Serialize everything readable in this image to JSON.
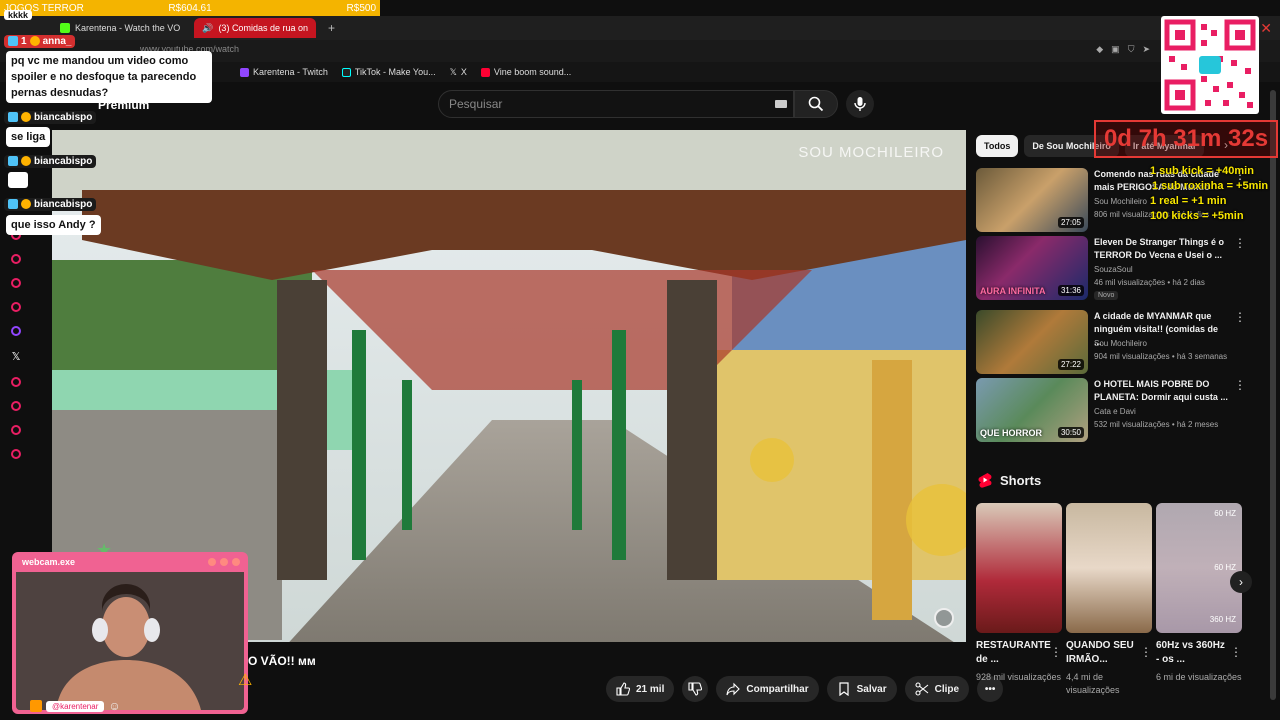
{
  "overlay": {
    "goal_bar": [
      "JOGOS TERROR",
      "R$604.61",
      "R$500"
    ],
    "chat": [
      {
        "kind": "text-only",
        "text": "kkkk"
      },
      {
        "kind": "message",
        "user": "anna_",
        "badge": "1",
        "text": "pq vc me mandou um video como spoiler e no desfoque ta parecendo pernas desnudas?"
      },
      {
        "kind": "message",
        "user": "biancabispo",
        "text": "se liga"
      },
      {
        "kind": "message",
        "user": "biancabispo",
        "text": ""
      },
      {
        "kind": "message",
        "user": "biancabispo",
        "text": "que isso Andy ?"
      }
    ],
    "timer": "0d 7h 31m 32s",
    "rules": [
      "1 sub kick = +40min",
      "1 sub roxinha = +5min",
      "1 real = +1 min",
      "100 kicks = +5min"
    ],
    "webcam_title": "webcam.exe",
    "handle": "@karentenar"
  },
  "browser": {
    "tabs": [
      {
        "label": "Karentena - Watch the VO",
        "active": false
      },
      {
        "label": "(3) Comidas de rua on",
        "active": true
      }
    ],
    "url": "www.youtube.com/watch",
    "bookmarks": [
      "Karentena - Twitch",
      "TikTok - Make You...",
      "X",
      "Vine boom sound..."
    ]
  },
  "youtube": {
    "premium_label": "Premium",
    "search_placeholder": "Pesquisar",
    "video": {
      "watermark": "SOU MOCHILEIRO",
      "title_fragment": "O VÃO!! мм",
      "likes": "21 mil",
      "share": "Compartilhar",
      "save": "Salvar",
      "clip": "Clipe"
    },
    "chips": [
      "Todos",
      "De Sou Mochileiro",
      "Ir até Myanmar"
    ],
    "recommendations": [
      {
        "title": "Comendo nas ruas da cidade mais PERIGOSA do Mundo",
        "channel": "Sou Mochileiro",
        "meta": "806 mil visualizações • há 4 dias",
        "duration": "27:05",
        "badge": "",
        "thumb_text": ""
      },
      {
        "title": "Eleven De Stranger Things é o TERROR Do Vecna e Usei o ...",
        "channel": "SouzaSoul",
        "meta": "46 mil visualizações • há 2 dias",
        "duration": "31:36",
        "badge": "Novo",
        "thumb_text": "AURA INFINITA"
      },
      {
        "title": "A cidade de MYANMAR que ninguém visita!! (comidas de ...",
        "channel": "Sou Mochileiro",
        "meta": "904 mil visualizações • há 3 semanas",
        "duration": "27:22",
        "badge": "",
        "thumb_text": ""
      },
      {
        "title": "O HOTEL MAIS POBRE DO PLANETA: Dormir aqui custa ...",
        "channel": "Cata e Davi",
        "meta": "532 mil visualizações • há 2 meses",
        "duration": "30:50",
        "badge": "",
        "thumb_text": "QUE HORROR"
      }
    ],
    "shorts_label": "Shorts",
    "shorts": [
      {
        "title": "RESTAURANTE de ...",
        "views": "928 mil visualizações"
      },
      {
        "title": "QUANDO SEU IRMÃO...",
        "views": "4,4 mi de visualizações"
      },
      {
        "title": "60Hz vs 360Hz - os ...",
        "views": "6 mi de visualizações",
        "hz": [
          "60 HZ",
          "60 HZ",
          "360 HZ"
        ]
      }
    ]
  }
}
